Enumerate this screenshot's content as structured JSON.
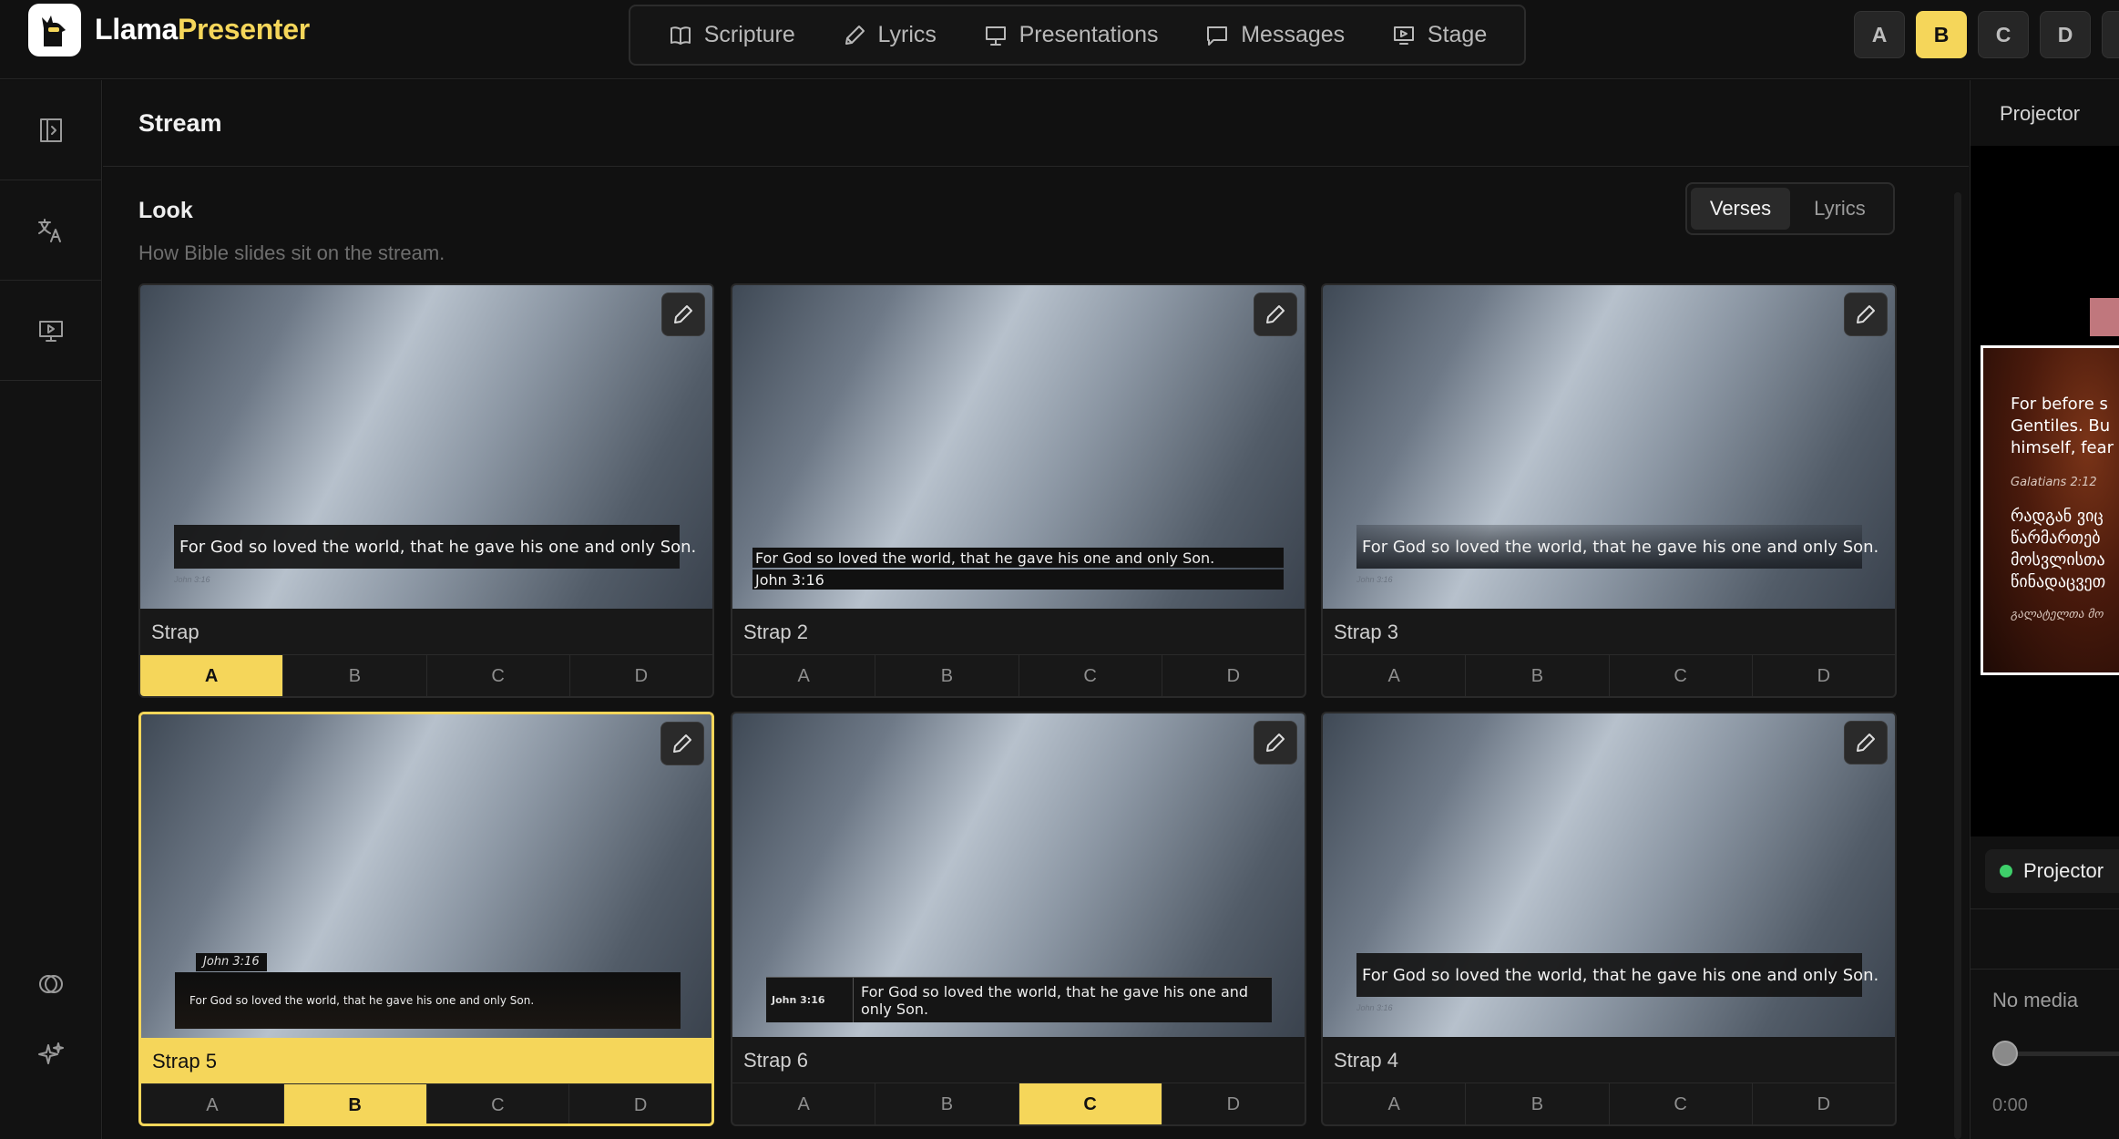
{
  "app": {
    "brand_part1": "Llama",
    "brand_part2": "Presenter",
    "accent": "#f5d65a"
  },
  "nav": {
    "items": [
      {
        "label": "Scripture",
        "icon": "book-icon"
      },
      {
        "label": "Lyrics",
        "icon": "pen-icon"
      },
      {
        "label": "Presentations",
        "icon": "presentation-icon"
      },
      {
        "label": "Messages",
        "icon": "message-icon"
      },
      {
        "label": "Stage",
        "icon": "stage-icon"
      }
    ]
  },
  "profiles": {
    "items": [
      "A",
      "B",
      "C",
      "D"
    ],
    "active": "B"
  },
  "stream": {
    "title": "Stream"
  },
  "look": {
    "title": "Look",
    "subtitle": "How Bible slides sit on the stream."
  },
  "toggle": {
    "options": [
      "Verses",
      "Lyrics"
    ],
    "active": "Verses"
  },
  "verse": {
    "text": "For God so loved the world, that he gave his one and only Son.",
    "ref": "John 3:16",
    "text6_line1": "For God so loved the world, that he gave his one and",
    "text6_line2": "only Son."
  },
  "cards": [
    {
      "name": "Strap",
      "options": [
        "A",
        "B",
        "C",
        "D"
      ],
      "selected": "A"
    },
    {
      "name": "Strap 2",
      "options": [
        "A",
        "B",
        "C",
        "D"
      ],
      "selected": null
    },
    {
      "name": "Strap 3",
      "options": [
        "A",
        "B",
        "C",
        "D"
      ],
      "selected": null
    },
    {
      "name": "Strap 5",
      "options": [
        "A",
        "B",
        "C",
        "D"
      ],
      "selected": "B",
      "highlighted": true
    },
    {
      "name": "Strap 6",
      "options": [
        "A",
        "B",
        "C",
        "D"
      ],
      "selected": "C"
    },
    {
      "name": "Strap 4",
      "options": [
        "A",
        "B",
        "C",
        "D"
      ],
      "selected": null
    }
  ],
  "projector": {
    "title": "Projector",
    "slide_lines": [
      "For before s",
      "Gentiles. Bu",
      "himself, fear"
    ],
    "slide_ref": "Galatians 2:12",
    "slide_lines_ka": [
      "რადგან ვიც",
      "წარმართებ",
      "მოსვლისთა",
      "წინადაცვეთ"
    ],
    "slide_ref_ka": "გალატელთა მო",
    "status_label": "Projector",
    "no_media": "No media",
    "time": "0:00"
  }
}
